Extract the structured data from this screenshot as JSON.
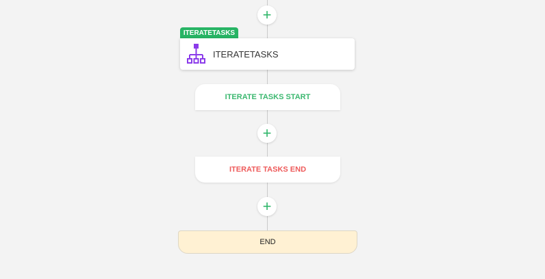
{
  "flow": {
    "add_step_symbol": "+",
    "iterate_tag": "ITERATETASKS",
    "iterate_card_title": "ITERATETASKS",
    "iterate_start": "ITERATE TASKS START",
    "iterate_end": "ITERATE TASKS END",
    "end_label": "END"
  },
  "colors": {
    "accent": "#27b464",
    "start": "#3cb870",
    "end": "#ee5a5a",
    "icon": "#8b3bea"
  }
}
